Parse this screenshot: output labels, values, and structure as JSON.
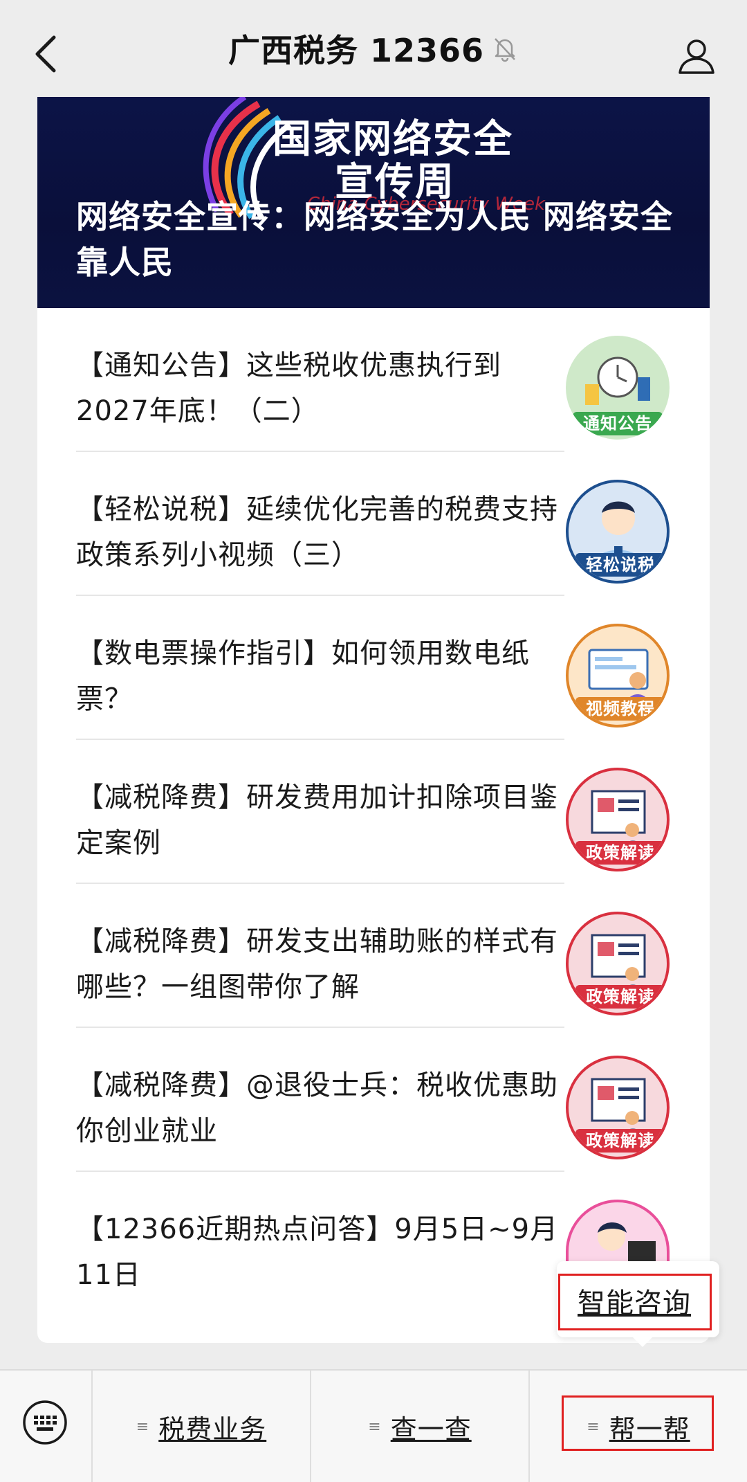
{
  "header": {
    "title": "广西税务 12366",
    "back_icon": "chevron-left-icon",
    "mute_icon": "bell-slash-icon",
    "profile_icon": "person-icon"
  },
  "banner": {
    "logo_line1": "国家网络安全",
    "logo_line2": "宣传周",
    "logo_sub": "China Cybersecurity Week",
    "title": "网络安全宣传：网络安全为人民 网络安全靠人民"
  },
  "articles": [
    {
      "text": "【通知公告】这些税收优惠执行到2027年底！（二）",
      "thumb_label": "通知公告",
      "thumb_color": "#3aa84f",
      "thumb_bg": "#cfe9c9"
    },
    {
      "text": "【轻松说税】延续优化完善的税费支持政策系列小视频（三）",
      "thumb_label": "轻松说税",
      "thumb_color": "#1d4f8f",
      "thumb_bg": "#d9e6f5"
    },
    {
      "text": "【数电票操作指引】如何领用数电纸票？",
      "thumb_label": "视频教程",
      "thumb_color": "#e0862a",
      "thumb_bg": "#fde6c8"
    },
    {
      "text": "【减税降费】研发费用加计扣除项目鉴定案例",
      "thumb_label": "政策解读",
      "thumb_color": "#d9303f",
      "thumb_bg": "#f7d9dd"
    },
    {
      "text": "【减税降费】研发支出辅助账的样式有哪些？一组图带你了解",
      "thumb_label": "政策解读",
      "thumb_color": "#d9303f",
      "thumb_bg": "#f7d9dd"
    },
    {
      "text": "【减税降费】@退役士兵：税收优惠助你创业就业",
      "thumb_label": "政策解读",
      "thumb_color": "#d9303f",
      "thumb_bg": "#f7d9dd"
    },
    {
      "text": "【12366近期热点问答】9月5日~9月11日",
      "thumb_label": "",
      "thumb_color": "#e94f9a",
      "thumb_bg": "#fbd6e8"
    }
  ],
  "tooltip": {
    "text": "智能咨询"
  },
  "bottom_menu": {
    "keyboard_icon": "keyboard-icon",
    "items": [
      {
        "label": "税费业务"
      },
      {
        "label": "查一查"
      },
      {
        "label": "帮一帮"
      }
    ]
  },
  "colors": {
    "highlight": "#e02020",
    "banner_bg": "#0c1447",
    "page_bg": "#ededed"
  }
}
